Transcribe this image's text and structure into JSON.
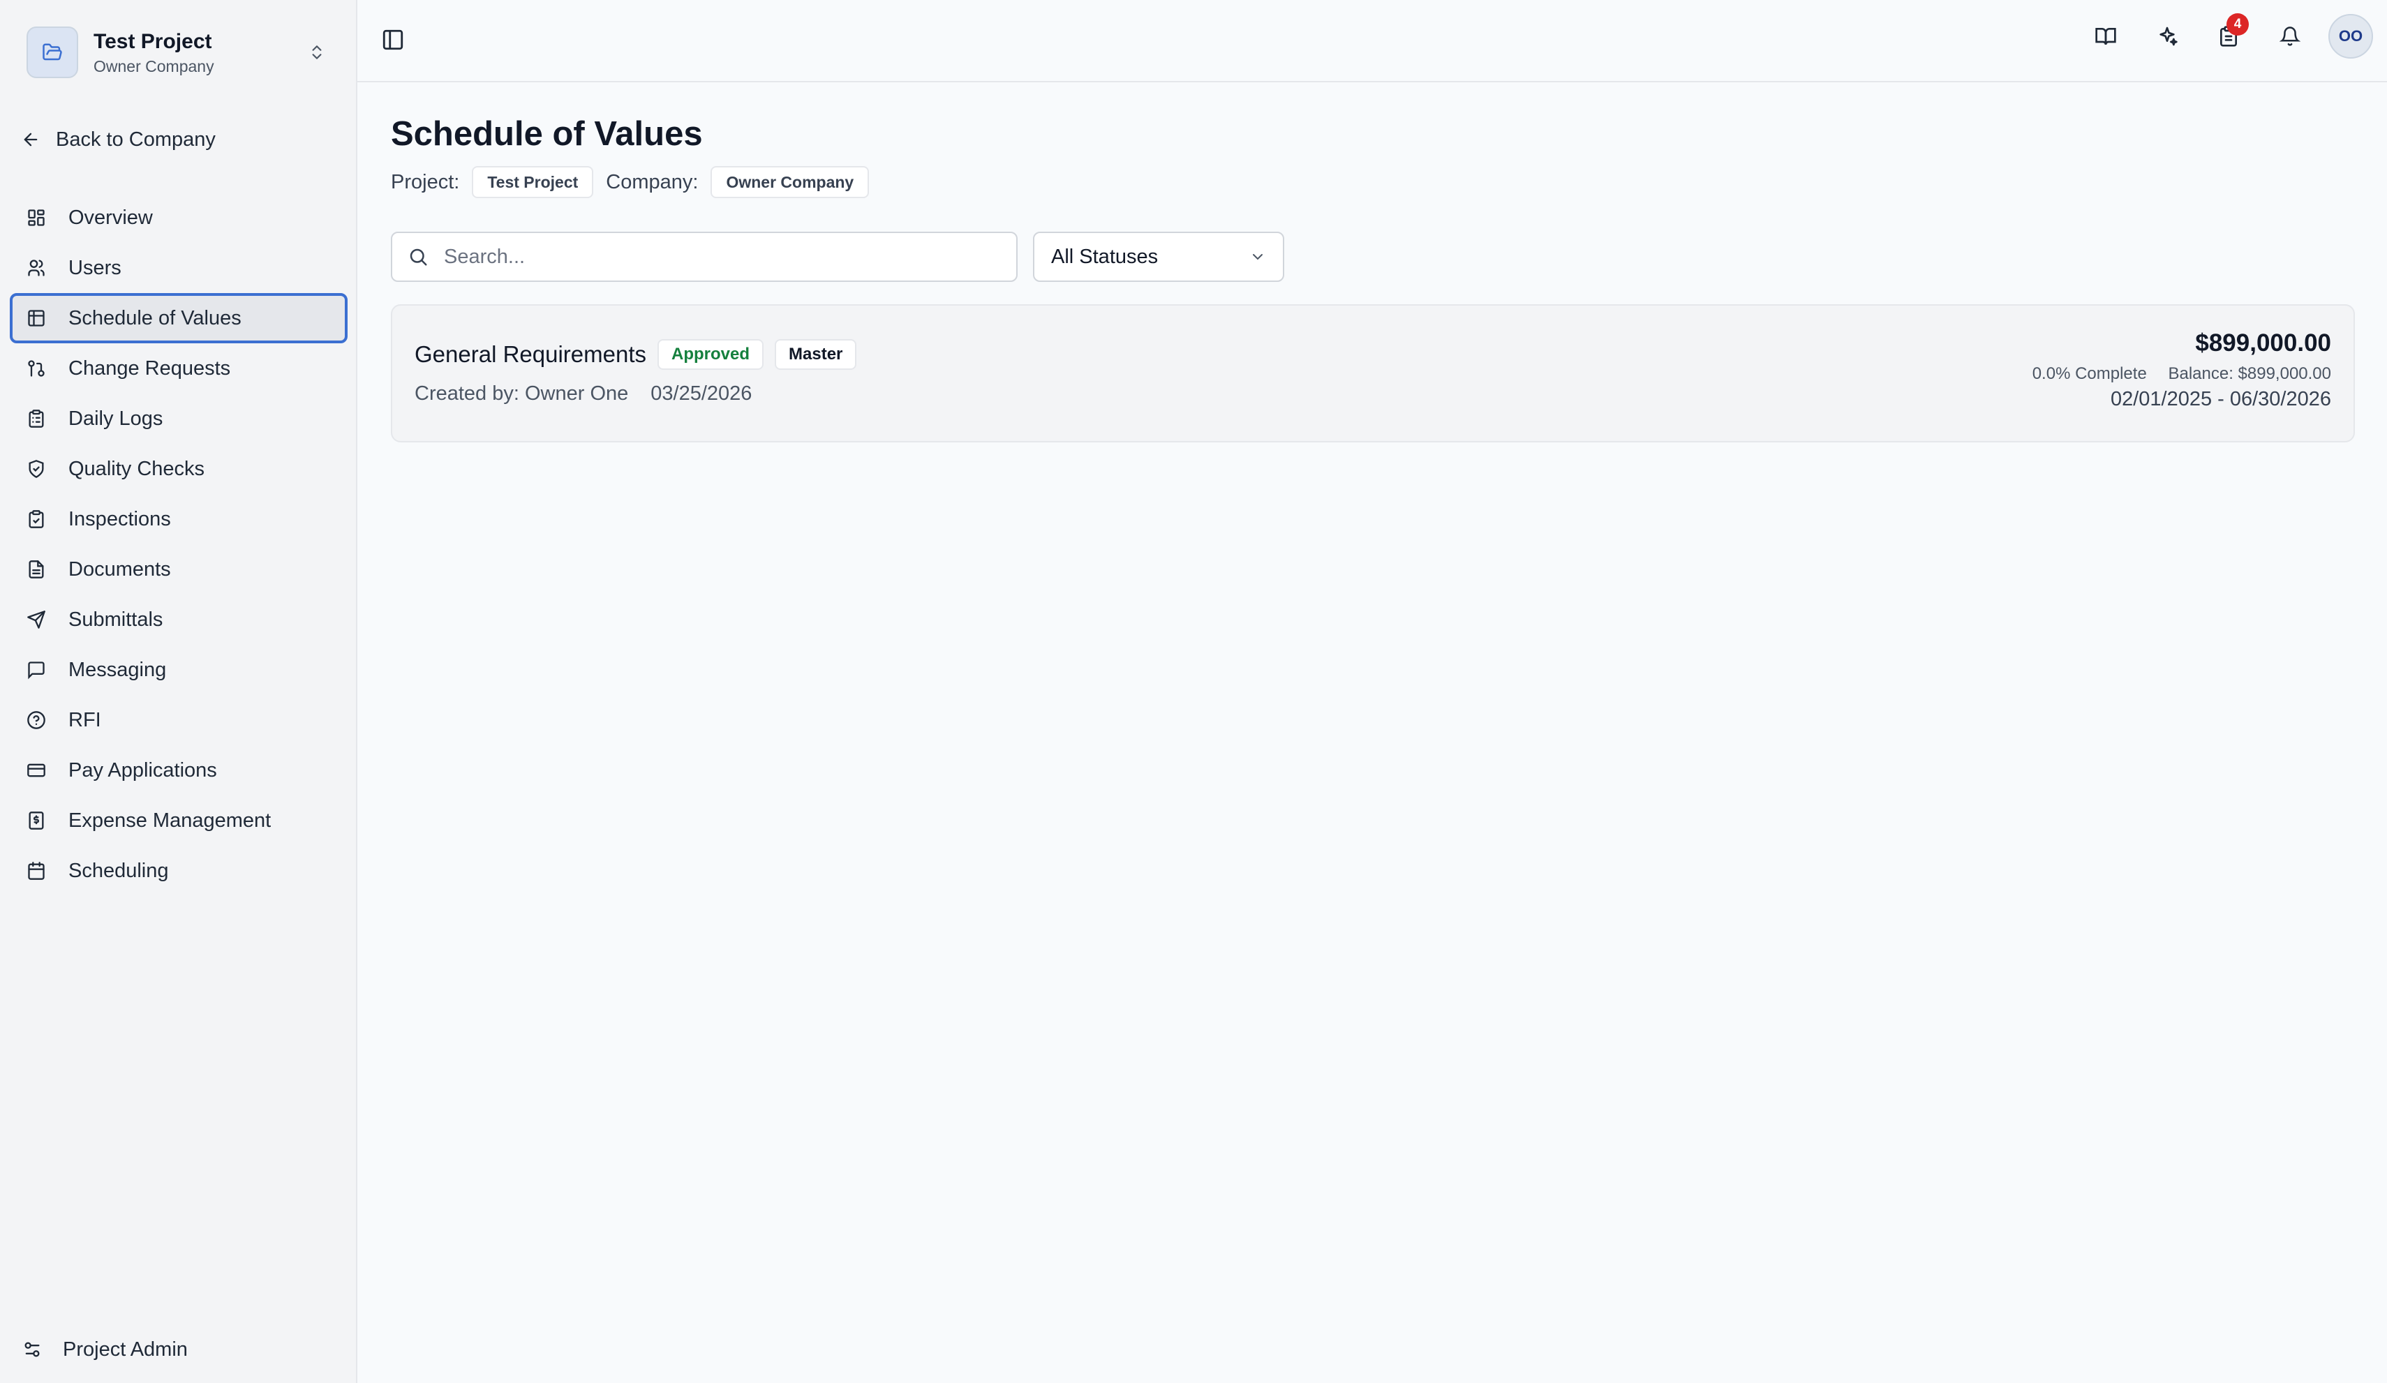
{
  "project_switcher": {
    "project_name": "Test Project",
    "company_name": "Owner Company"
  },
  "sidebar": {
    "back_label": "Back to Company",
    "items": [
      {
        "label": "Overview",
        "icon": "dashboard-icon"
      },
      {
        "label": "Users",
        "icon": "users-icon"
      },
      {
        "label": "Schedule of Values",
        "icon": "table-icon",
        "active": true
      },
      {
        "label": "Change Requests",
        "icon": "git-compare-icon"
      },
      {
        "label": "Daily Logs",
        "icon": "clipboard-list-icon"
      },
      {
        "label": "Quality Checks",
        "icon": "shield-check-icon"
      },
      {
        "label": "Inspections",
        "icon": "clipboard-check-icon"
      },
      {
        "label": "Documents",
        "icon": "file-text-icon"
      },
      {
        "label": "Submittals",
        "icon": "send-icon"
      },
      {
        "label": "Messaging",
        "icon": "message-square-icon"
      },
      {
        "label": "RFI",
        "icon": "help-circle-icon"
      },
      {
        "label": "Pay Applications",
        "icon": "credit-card-icon"
      },
      {
        "label": "Expense Management",
        "icon": "receipt-icon"
      },
      {
        "label": "Scheduling",
        "icon": "calendar-icon"
      }
    ],
    "admin_label": "Project Admin"
  },
  "topbar": {
    "tasks_badge": "4",
    "avatar_initials": "OO"
  },
  "page": {
    "title": "Schedule of Values",
    "project_label": "Project:",
    "project_value": "Test Project",
    "company_label": "Company:",
    "company_value": "Owner Company"
  },
  "filters": {
    "search_placeholder": "Search...",
    "search_value": "",
    "status_selected": "All Statuses"
  },
  "sov_items": [
    {
      "name": "General Requirements",
      "status": "Approved",
      "type": "Master",
      "created_by": "Created by: Owner One",
      "created_date": "03/25/2026",
      "amount": "$899,000.00",
      "percent_complete": "0.0% Complete",
      "balance": "Balance: $899,000.00",
      "date_range": "02/01/2025 - 06/30/2026"
    }
  ],
  "colors": {
    "accent": "#3b6fd1",
    "approved": "#15803d",
    "badge": "#dc2626"
  }
}
